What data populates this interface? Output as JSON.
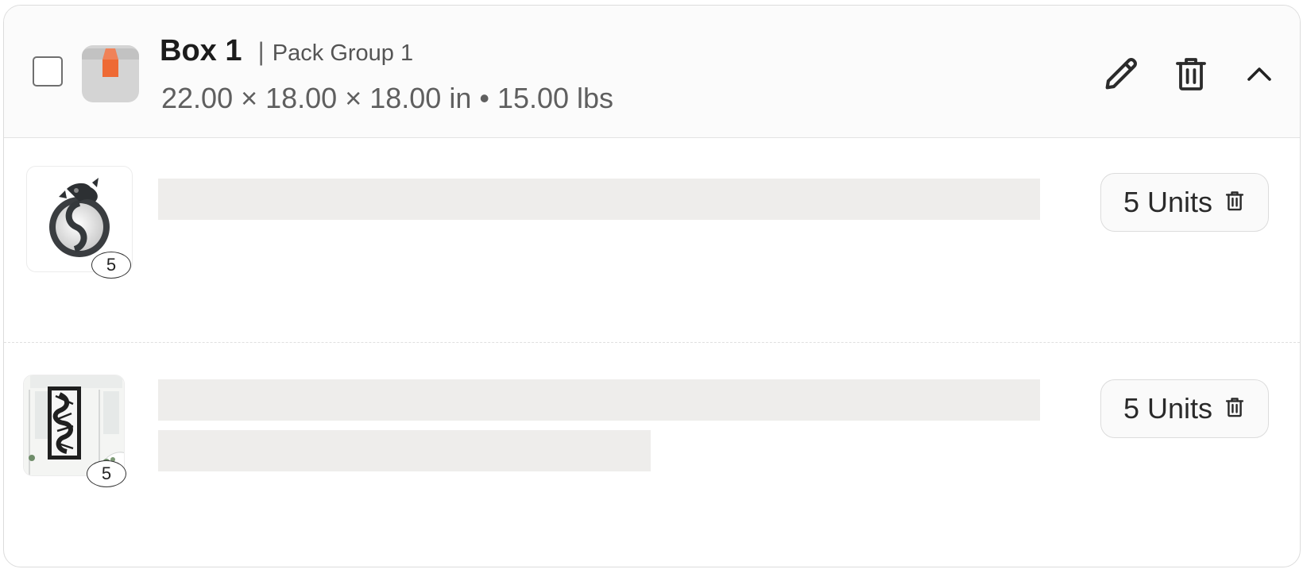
{
  "box": {
    "title": "Box 1",
    "separator": "|",
    "group": "Pack Group 1",
    "dimensions": "22.00 × 18.00 × 18.00 in • 15.00 lbs",
    "selected": false
  },
  "actions": {
    "edit_icon": "pencil-icon",
    "delete_icon": "trash-icon",
    "collapse_icon": "chevron-up-icon"
  },
  "items": [
    {
      "thumbnail": "ouroboros-dragon-wall-art",
      "quantity": "5",
      "units_label": "5 Units"
    },
    {
      "thumbnail": "dragon-panel-wall-art",
      "quantity": "5",
      "units_label": "5 Units"
    }
  ],
  "colors": {
    "accent_orange": "#ee6a35",
    "skeleton": "#eeedeb",
    "border": "#dcdcdc"
  }
}
